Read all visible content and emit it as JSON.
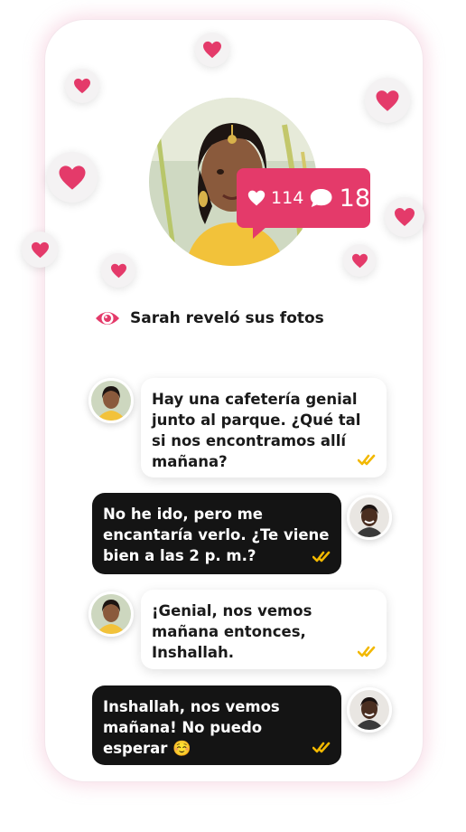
{
  "profile": {
    "likes": "114",
    "comments": "18"
  },
  "reveal": {
    "text": "Sarah reveló sus fotos"
  },
  "messages": [
    {
      "sender": "sarah",
      "text": "Hay una cafetería genial junto al parque. ¿Qué tal si nos encontramos allí mañana?"
    },
    {
      "sender": "match",
      "text": "No he ido, pero me encantaría verlo. ¿Te viene bien a las 2 p. m.?"
    },
    {
      "sender": "sarah",
      "text": "¡Genial, nos vemos mañana entonces, Inshallah."
    },
    {
      "sender": "match",
      "text": "Inshallah, nos vemos mañana! No puedo esperar ☺️"
    }
  ],
  "colors": {
    "accent": "#e43a6a",
    "check": "#f2b800",
    "outgoing_bubble": "#141414"
  }
}
